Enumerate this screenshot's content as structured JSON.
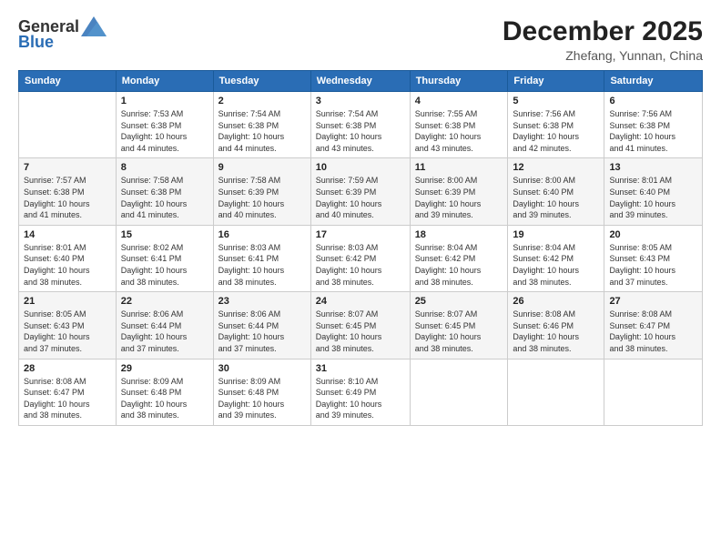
{
  "header": {
    "logo_general": "General",
    "logo_blue": "Blue",
    "title": "December 2025",
    "subtitle": "Zhefang, Yunnan, China"
  },
  "calendar": {
    "days_of_week": [
      "Sunday",
      "Monday",
      "Tuesday",
      "Wednesday",
      "Thursday",
      "Friday",
      "Saturday"
    ],
    "weeks": [
      [
        {
          "day": "",
          "info": ""
        },
        {
          "day": "1",
          "info": "Sunrise: 7:53 AM\nSunset: 6:38 PM\nDaylight: 10 hours\nand 44 minutes."
        },
        {
          "day": "2",
          "info": "Sunrise: 7:54 AM\nSunset: 6:38 PM\nDaylight: 10 hours\nand 44 minutes."
        },
        {
          "day": "3",
          "info": "Sunrise: 7:54 AM\nSunset: 6:38 PM\nDaylight: 10 hours\nand 43 minutes."
        },
        {
          "day": "4",
          "info": "Sunrise: 7:55 AM\nSunset: 6:38 PM\nDaylight: 10 hours\nand 43 minutes."
        },
        {
          "day": "5",
          "info": "Sunrise: 7:56 AM\nSunset: 6:38 PM\nDaylight: 10 hours\nand 42 minutes."
        },
        {
          "day": "6",
          "info": "Sunrise: 7:56 AM\nSunset: 6:38 PM\nDaylight: 10 hours\nand 41 minutes."
        }
      ],
      [
        {
          "day": "7",
          "info": "Sunrise: 7:57 AM\nSunset: 6:38 PM\nDaylight: 10 hours\nand 41 minutes."
        },
        {
          "day": "8",
          "info": "Sunrise: 7:58 AM\nSunset: 6:38 PM\nDaylight: 10 hours\nand 41 minutes."
        },
        {
          "day": "9",
          "info": "Sunrise: 7:58 AM\nSunset: 6:39 PM\nDaylight: 10 hours\nand 40 minutes."
        },
        {
          "day": "10",
          "info": "Sunrise: 7:59 AM\nSunset: 6:39 PM\nDaylight: 10 hours\nand 40 minutes."
        },
        {
          "day": "11",
          "info": "Sunrise: 8:00 AM\nSunset: 6:39 PM\nDaylight: 10 hours\nand 39 minutes."
        },
        {
          "day": "12",
          "info": "Sunrise: 8:00 AM\nSunset: 6:40 PM\nDaylight: 10 hours\nand 39 minutes."
        },
        {
          "day": "13",
          "info": "Sunrise: 8:01 AM\nSunset: 6:40 PM\nDaylight: 10 hours\nand 39 minutes."
        }
      ],
      [
        {
          "day": "14",
          "info": "Sunrise: 8:01 AM\nSunset: 6:40 PM\nDaylight: 10 hours\nand 38 minutes."
        },
        {
          "day": "15",
          "info": "Sunrise: 8:02 AM\nSunset: 6:41 PM\nDaylight: 10 hours\nand 38 minutes."
        },
        {
          "day": "16",
          "info": "Sunrise: 8:03 AM\nSunset: 6:41 PM\nDaylight: 10 hours\nand 38 minutes."
        },
        {
          "day": "17",
          "info": "Sunrise: 8:03 AM\nSunset: 6:42 PM\nDaylight: 10 hours\nand 38 minutes."
        },
        {
          "day": "18",
          "info": "Sunrise: 8:04 AM\nSunset: 6:42 PM\nDaylight: 10 hours\nand 38 minutes."
        },
        {
          "day": "19",
          "info": "Sunrise: 8:04 AM\nSunset: 6:42 PM\nDaylight: 10 hours\nand 38 minutes."
        },
        {
          "day": "20",
          "info": "Sunrise: 8:05 AM\nSunset: 6:43 PM\nDaylight: 10 hours\nand 37 minutes."
        }
      ],
      [
        {
          "day": "21",
          "info": "Sunrise: 8:05 AM\nSunset: 6:43 PM\nDaylight: 10 hours\nand 37 minutes."
        },
        {
          "day": "22",
          "info": "Sunrise: 8:06 AM\nSunset: 6:44 PM\nDaylight: 10 hours\nand 37 minutes."
        },
        {
          "day": "23",
          "info": "Sunrise: 8:06 AM\nSunset: 6:44 PM\nDaylight: 10 hours\nand 37 minutes."
        },
        {
          "day": "24",
          "info": "Sunrise: 8:07 AM\nSunset: 6:45 PM\nDaylight: 10 hours\nand 38 minutes."
        },
        {
          "day": "25",
          "info": "Sunrise: 8:07 AM\nSunset: 6:45 PM\nDaylight: 10 hours\nand 38 minutes."
        },
        {
          "day": "26",
          "info": "Sunrise: 8:08 AM\nSunset: 6:46 PM\nDaylight: 10 hours\nand 38 minutes."
        },
        {
          "day": "27",
          "info": "Sunrise: 8:08 AM\nSunset: 6:47 PM\nDaylight: 10 hours\nand 38 minutes."
        }
      ],
      [
        {
          "day": "28",
          "info": "Sunrise: 8:08 AM\nSunset: 6:47 PM\nDaylight: 10 hours\nand 38 minutes."
        },
        {
          "day": "29",
          "info": "Sunrise: 8:09 AM\nSunset: 6:48 PM\nDaylight: 10 hours\nand 38 minutes."
        },
        {
          "day": "30",
          "info": "Sunrise: 8:09 AM\nSunset: 6:48 PM\nDaylight: 10 hours\nand 39 minutes."
        },
        {
          "day": "31",
          "info": "Sunrise: 8:10 AM\nSunset: 6:49 PM\nDaylight: 10 hours\nand 39 minutes."
        },
        {
          "day": "",
          "info": ""
        },
        {
          "day": "",
          "info": ""
        },
        {
          "day": "",
          "info": ""
        }
      ]
    ]
  }
}
